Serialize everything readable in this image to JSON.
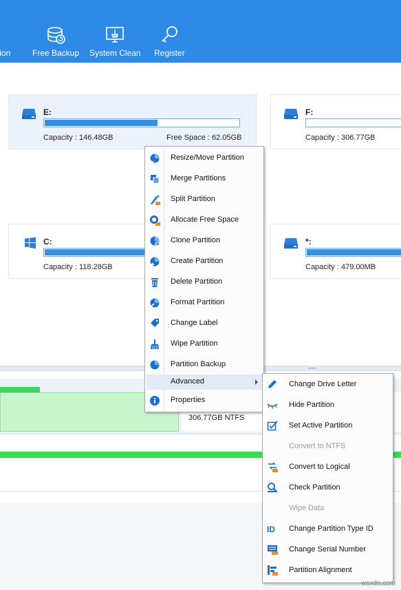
{
  "toolbar": {
    "items": [
      {
        "label": "tition",
        "icon": "partition-icon"
      },
      {
        "label": "Free Backup",
        "icon": "backup-icon"
      },
      {
        "label": "System Clean",
        "icon": "system-clean-icon"
      },
      {
        "label": "Register",
        "icon": "key-icon"
      }
    ]
  },
  "drives": [
    {
      "name": "E:",
      "capacity": "Capacity : 146.48GB",
      "free": "Free Space : 62.05GB",
      "used_fraction": 0.58,
      "selected": true,
      "icon": "hard-drive-icon"
    },
    {
      "name": "F:",
      "capacity": "Capacity : 306.77GB",
      "used_fraction": 0.0,
      "icon": "hard-drive-icon"
    },
    {
      "name": "C:",
      "capacity": "Capacity : 118.28GB",
      "used_fraction": 1.0,
      "icon": "windows-icon"
    },
    {
      "name": "*:",
      "capacity": "Capacity : 479.00MB",
      "used_fraction": 1.0,
      "icon": "hard-drive-icon"
    }
  ],
  "map": {
    "ntfs_label": "306.77GB NTFS"
  },
  "context_menu": {
    "items": [
      {
        "label": "Resize/Move Partition",
        "icon": "resize-icon"
      },
      {
        "label": "Merge Partitions",
        "icon": "merge-icon"
      },
      {
        "label": "Split Partition",
        "icon": "split-icon"
      },
      {
        "label": "Allocate Free Space",
        "icon": "allocate-icon"
      },
      {
        "label": "Clone Partition",
        "icon": "clone-icon"
      },
      {
        "label": "Create Partition",
        "icon": "create-icon"
      },
      {
        "label": "Delete Partition",
        "icon": "delete-icon"
      },
      {
        "label": "Format Partition",
        "icon": "format-icon"
      },
      {
        "label": "Change Label",
        "icon": "label-icon"
      },
      {
        "label": "Wipe Partition",
        "icon": "wipe-icon"
      },
      {
        "label": "Partition Backup",
        "icon": "backup-icon"
      },
      {
        "label": "Advanced",
        "icon": "",
        "has_submenu": true
      },
      {
        "label": "Properties",
        "icon": "info-icon"
      }
    ]
  },
  "advanced_menu": {
    "items": [
      {
        "label": "Change Drive Letter",
        "icon": "pencil-icon",
        "enabled": true
      },
      {
        "label": "Hide Partition",
        "icon": "hide-icon",
        "enabled": true
      },
      {
        "label": "Set Active Partition",
        "icon": "set-active-icon",
        "enabled": true
      },
      {
        "label": "Convert to NTFS",
        "icon": "",
        "enabled": false
      },
      {
        "label": "Convert to Logical",
        "icon": "convert-icon",
        "enabled": true
      },
      {
        "label": "Check Partition",
        "icon": "check-icon",
        "enabled": true
      },
      {
        "label": "Wipe Data",
        "icon": "",
        "enabled": false
      },
      {
        "label": "Change Partition Type ID",
        "icon": "id-icon",
        "enabled": true
      },
      {
        "label": "Change Serial Number",
        "icon": "serial-icon",
        "enabled": true
      },
      {
        "label": "Partition Alignment",
        "icon": "alignment-icon",
        "enabled": true
      }
    ]
  },
  "watermark": "wsxdn.com",
  "colors": {
    "toolbar": "#2e8ae6",
    "accent": "#3b8de0",
    "green": "#3dd65a",
    "icon_blue": "#1f6fc5"
  }
}
